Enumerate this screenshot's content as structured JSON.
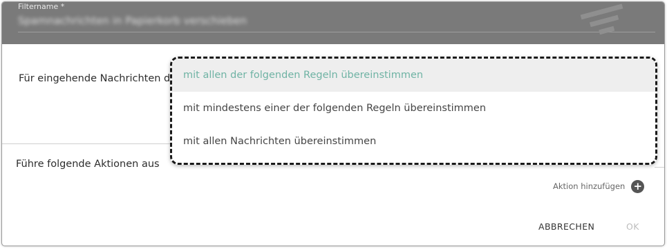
{
  "filter": {
    "label": "Filtername *",
    "value": "Spamnachrichten in Papierkorb verschieben"
  },
  "incoming": {
    "label": "Für eingehende Nachrichten d"
  },
  "dropdown": {
    "options": [
      {
        "label": "mit allen der folgenden Regeln übereinstimmen",
        "selected": true
      },
      {
        "label": "mit mindestens einer der folgenden Regeln übereinstimmen",
        "selected": false
      },
      {
        "label": "mit allen Nachrichten übereinstimmen",
        "selected": false
      }
    ],
    "selected_color": "#6fb3a4"
  },
  "actions": {
    "label": "Führe folgende Aktionen aus",
    "add_label": "Aktion hinzufügen"
  },
  "footer": {
    "cancel_label": "ABBRECHEN",
    "ok_label": "OK"
  },
  "icons": {
    "filter": "filter-icon",
    "add": "plus-circle-icon"
  }
}
